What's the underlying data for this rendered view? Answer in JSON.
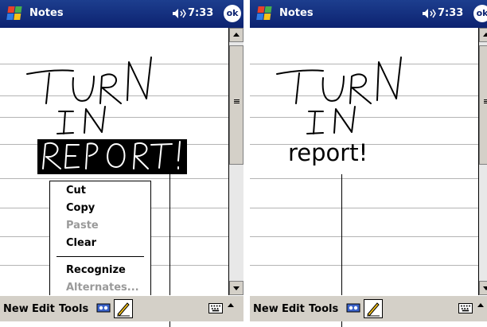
{
  "left": {
    "title": "Notes",
    "time": "7:33",
    "ok_label": "ok",
    "menu": {
      "new": "New",
      "edit": "Edit",
      "tools": "Tools"
    },
    "context_menu": {
      "items": [
        {
          "label": "Cut",
          "enabled": true
        },
        {
          "label": "Copy",
          "enabled": true
        },
        {
          "label": "Paste",
          "enabled": false
        },
        {
          "label": "Clear",
          "enabled": true
        },
        {
          "label": "Recognize",
          "enabled": true
        },
        {
          "label": "Alternates...",
          "enabled": false
        }
      ]
    },
    "ink_text": "TURN IN REPORT!"
  },
  "right": {
    "title": "Notes",
    "time": "7:33",
    "ok_label": "ok",
    "menu": {
      "new": "New",
      "edit": "Edit",
      "tools": "Tools"
    },
    "ink_text": "TURN IN",
    "recognized_text": "report!"
  },
  "colors": {
    "titlebar": "#0c2270",
    "menubar": "#d4d0c8",
    "rule": "#b4b4b4"
  }
}
